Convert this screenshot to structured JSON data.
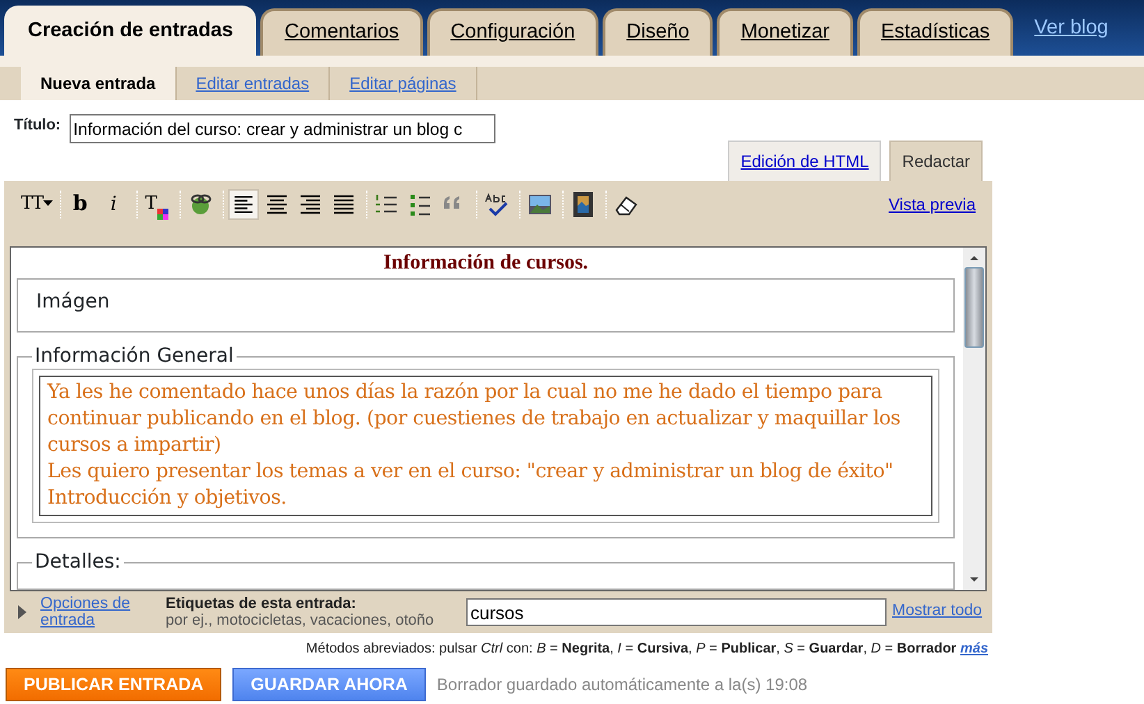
{
  "tabs": [
    {
      "label": "Creación de entradas",
      "selected": true
    },
    {
      "label": "Comentarios",
      "selected": false
    },
    {
      "label": "Configuración",
      "selected": false
    },
    {
      "label": "Diseño",
      "selected": false
    },
    {
      "label": "Monetizar",
      "selected": false
    },
    {
      "label": "Estadísticas",
      "selected": false
    }
  ],
  "view_blog_link": "Ver blog",
  "subtabs": [
    {
      "label": "Nueva entrada",
      "selected": true
    },
    {
      "label": "Editar entradas",
      "selected": false
    },
    {
      "label": "Editar páginas",
      "selected": false
    }
  ],
  "title_field": {
    "label": "Título:",
    "value": "Información del curso: crear y administrar un blog c"
  },
  "mode_tabs": [
    {
      "label": "Edición de HTML",
      "selected": false
    },
    {
      "label": "Redactar",
      "selected": true
    }
  ],
  "toolbar": [
    {
      "kind": "font-size",
      "glyph": "TT"
    },
    {
      "kind": "bold",
      "glyph": "b"
    },
    {
      "kind": "italic",
      "glyph": "i"
    },
    {
      "kind": "text-color",
      "glyph": "T"
    },
    {
      "kind": "link"
    },
    {
      "kind": "align-left",
      "selected": true
    },
    {
      "kind": "align-center",
      "selected": false
    },
    {
      "kind": "align-right",
      "selected": false
    },
    {
      "kind": "justify",
      "selected": false
    },
    {
      "kind": "numbered-list"
    },
    {
      "kind": "bullet-list"
    },
    {
      "kind": "quote"
    },
    {
      "kind": "spellcheck"
    },
    {
      "kind": "image"
    },
    {
      "kind": "video"
    },
    {
      "kind": "eraser"
    }
  ],
  "preview_link": "Vista previa",
  "document": {
    "heading": "Información de cursos.",
    "sections": [
      {
        "kind": "box",
        "text": "Imágen"
      },
      {
        "kind": "fieldset",
        "legend": "Información General",
        "paragraphs": [
          "Ya les he comentado hace unos días la razón por la cual no me he dado el tiempo para continuar publicando en el blog. (por cuestienes de trabajo en actualizar y maquillar los cursos a impartir)",
          "Les quiero presentar los temas a ver en el curso: \"crear y administrar un blog de éxito\"",
          "Introducción y objetivos."
        ]
      },
      {
        "kind": "fieldset",
        "legend": "Detalles:"
      }
    ]
  },
  "post_options_link": "Opciones de entrada",
  "labels": {
    "label": "Etiquetas de esta entrada:",
    "hint": "por ej., motocicletas, vacaciones, otoño",
    "value": "cursos",
    "show_all_link": "Mostrar todo"
  },
  "shortcuts": {
    "text": "Métodos abreviados: pulsar *Ctrl* con: *B* = **Negrita**, *I* = **Cursiva**, *P* = **Publicar**, *S* = **Guardar**, *D* = **Borrador**",
    "more_link": "más"
  },
  "buttons": [
    {
      "kind": "publish",
      "label": "PUBLICAR ENTRADA"
    },
    {
      "kind": "save",
      "label": "GUARDAR AHORA"
    }
  ],
  "status": "Borrador guardado automáticamente a la(s) 19:08"
}
